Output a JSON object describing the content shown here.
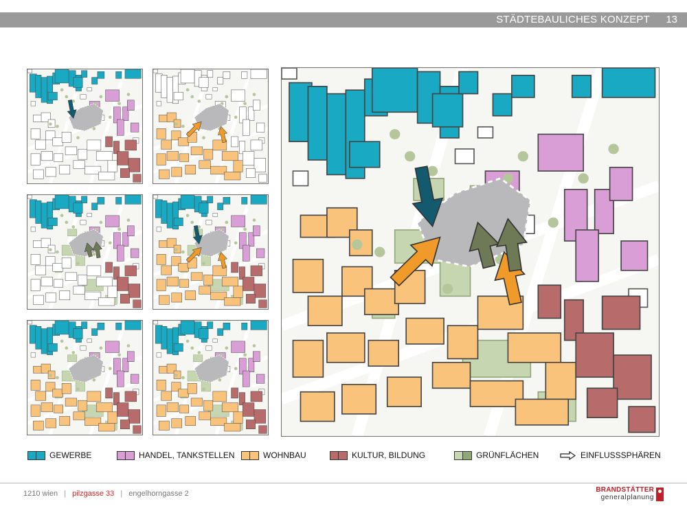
{
  "header": {
    "title": "STÄDTEBAULICHES KONZEPT",
    "page_number": "13"
  },
  "legend": [
    {
      "label": "GEWERBE",
      "colors": [
        "#1aa9c3",
        "#1aa9c3"
      ],
      "icon": "cyan-swatch"
    },
    {
      "label": "HANDEL, TANKSTELLEN",
      "colors": [
        "#d99ed6",
        "#d99ed6"
      ],
      "icon": "pink-swatch"
    },
    {
      "label": "WOHNBAU",
      "colors": [
        "#f9c37b",
        "#f9c37b"
      ],
      "icon": "orange-swatch"
    },
    {
      "label": "KULTUR, BILDUNG",
      "colors": [
        "#b86b6b",
        "#b86b6b"
      ],
      "icon": "red-swatch"
    },
    {
      "label": "GRÜNFLÄCHEN",
      "colors": [
        "#c6d6b0",
        "#8fa879"
      ],
      "icon": "green-swatch"
    },
    {
      "label": "EINFLUSSSPHÄREN",
      "icon": "arrow-icon"
    }
  ],
  "footer": {
    "part1": "1210 wien",
    "part2": "pilzgasse 33",
    "part3": "engelhorngasse 2",
    "separator": "|"
  },
  "logo": {
    "line1": "BRANDSTÄTTER",
    "line2": "generalplanung"
  },
  "colors": {
    "gewerbe": "#1aa9c3",
    "handel": "#d99ed6",
    "wohnbau": "#f9c37b",
    "kultur": "#b86b6b",
    "gruen": "#c6d6b0",
    "gruen_dark": "#8fa879",
    "site": "#b9b9bb",
    "arrow_teal": "#135a6e",
    "arrow_orange": "#f09a2a",
    "arrow_green": "#6d7a55"
  }
}
